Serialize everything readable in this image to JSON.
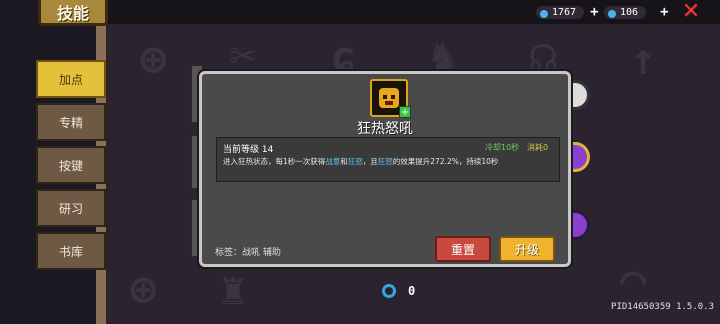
{
  "header": {
    "title": "技能"
  },
  "resources": {
    "gems": {
      "value": "1767",
      "color": "#49b4e8",
      "icon": "gem-icon"
    },
    "energy": {
      "value": "106",
      "color": "#49b4e8",
      "icon": "energy-icon"
    },
    "plus_label": "+",
    "close_label": "✕"
  },
  "sidebar": {
    "items": [
      {
        "label": "加点",
        "active": true
      },
      {
        "label": "专精",
        "active": false
      },
      {
        "label": "按键",
        "active": false
      },
      {
        "label": "研习",
        "active": false
      },
      {
        "label": "书库",
        "active": false
      }
    ]
  },
  "dialog": {
    "skill_name": "狂热怒吼",
    "level_label": "当前等级 14",
    "cooldown": "冷却10秒",
    "cost": "消耗0",
    "description_parts": {
      "p1": "进入狂热状态，每1秒一次获得",
      "kw1": "战意",
      "p2": "和",
      "kw2": "狂怒",
      "p3": "，且",
      "kw3": "狂怒",
      "p4": "的效果提升272.2%，持续10秒"
    },
    "tags": "标签：战吼  辅助",
    "reset_label": "重置",
    "upgrade_label": "升级"
  },
  "footer": {
    "skill_points": "0",
    "version": "PID14650359 1.5.0.3"
  }
}
